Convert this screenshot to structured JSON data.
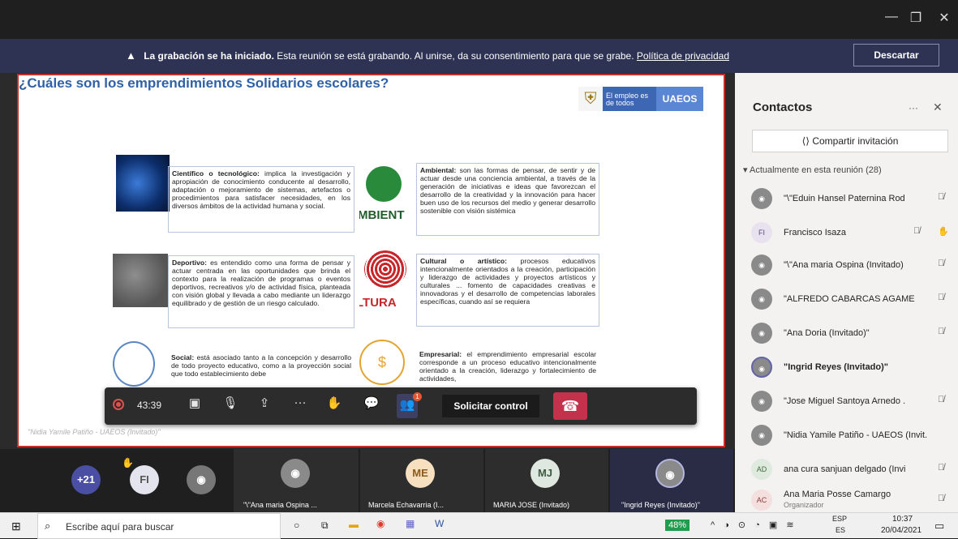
{
  "window": {
    "minimize": "—",
    "maximize": "❐",
    "close": "✕"
  },
  "banner": {
    "bold": "La grabación se ha iniciado.",
    "text": "Esta reunión se está grabando. Al unirse, da su consentimiento para que se grabe.",
    "link": "Política de privacidad",
    "discard": "Descartar"
  },
  "slide": {
    "title_words": [
      "¿Cuáles",
      "son",
      "los",
      "emprendimientos",
      "Solidarios escolares?"
    ],
    "logo": {
      "gov": "El empleo es de todos",
      "ua": "UAEOS"
    },
    "cards": [
      {
        "label": "Científico o tecnológico:",
        "text": "implica la investigación y apropiación de conocimiento conducente al desarrollo, adaptación o mejoramiento de sistemas, artefactos o procedimientos para satisfacer necesidades, en los diversos ámbitos de la actividad humana y social."
      },
      {
        "label": "Ambiental:",
        "text": "son las formas de pensar, de sentir y de actuar desde una conciencia ambiental, a través de la generación de iniciativas e ideas que favorezcan el desarrollo de la creatividad y la innovación para hacer buen uso de los recursos del medio y generar desarrollo sostenible con visión sistémica"
      },
      {
        "label": "Deportivo:",
        "text": "es entendido como una forma de pensar y actuar centrada en las oportunidades que brinda el contexto para la realización de programas o eventos deportivos, recreativos y/o de actividad física, planteada con visión global y llevada a cabo mediante un liderazgo equilibrado y de gestión de un riesgo calculado."
      },
      {
        "label": "Cultural o artístico:",
        "text": "procesos educativos intencionalmente orientados a la creación, participación y liderazgo de actividades y proyectos artísticos y culturales ... fomento de capacidades creativas e innovadoras y el desarrollo de competencias laborales específicas, cuando así se requiera"
      },
      {
        "label": "Social:",
        "text": "está asociado tanto a la concepción y desarrollo de todo proyecto educativo, como a la proyección social que todo establecimiento debe"
      },
      {
        "label": "Empresarial:",
        "text": "el emprendimiento empresarial escolar corresponde a un proceso educativo intencionalmente orientado a la creación, liderazgo y fortalecimiento de actividades,"
      }
    ],
    "img_words": {
      "ambient": "MBIENT",
      "cultura": "LTURA"
    },
    "presenter": "\"Nidia Yamile Patiño - UAEOS (Invitado)\""
  },
  "toolbar": {
    "time": "43:39",
    "badge": "1",
    "request_control": "Solicitar control"
  },
  "gallery": {
    "more": "+21",
    "tiles": [
      {
        "initials": "FI",
        "name": ""
      },
      {
        "initials": "",
        "name": "\"\\\"Ana maria Ospina ..."
      },
      {
        "initials": "ME",
        "name": "Marcela Echavarria (I..."
      },
      {
        "initials": "MJ",
        "name": "MARIA JOSE (Invitado)"
      },
      {
        "initials": "",
        "name": "\"Ingrid Reyes (Invitado)\""
      }
    ]
  },
  "panel": {
    "title": "Contactos",
    "more": "···",
    "close": "✕",
    "share": "Compartir invitación",
    "section": "Actualmente en esta reunión (28)",
    "people": [
      {
        "initials": "",
        "name": "\"\\\"Eduin Hansel Paternina Rod"
      },
      {
        "initials": "FI",
        "name": "Francisco Isaza"
      },
      {
        "initials": "",
        "name": "\"\\\"Ana maria Ospina (Invitado)"
      },
      {
        "initials": "",
        "name": "\"ALFREDO CABARCAS AGAME"
      },
      {
        "initials": "",
        "name": "\"Ana Doria (Invitado)\""
      },
      {
        "initials": "",
        "name": "\"Ingrid Reyes (Invitado)\""
      },
      {
        "initials": "",
        "name": "\"Jose Miguel Santoya Arnedo ."
      },
      {
        "initials": "",
        "name": "\"Nidia Yamile Patiño - UAEOS (Invit."
      },
      {
        "initials": "AD",
        "name": "ana cura sanjuan delgado (Invi"
      },
      {
        "initials": "AC",
        "name": "Ana Maria Posse Camargo",
        "sub": "Organizador"
      }
    ]
  },
  "taskbar": {
    "search": "Escribe aquí para buscar",
    "battery": "48%",
    "lang1": "ESP",
    "lang2": "ES",
    "time": "10:37",
    "date": "20/04/2021"
  }
}
